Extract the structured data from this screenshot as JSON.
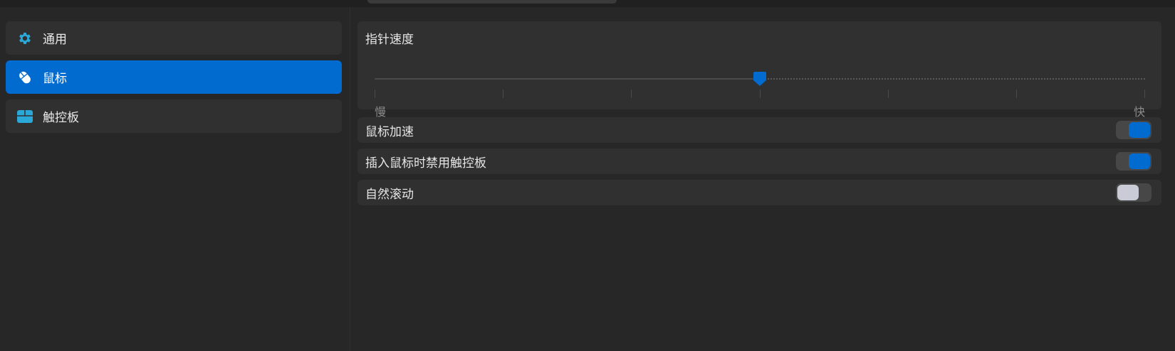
{
  "sidebar": {
    "items": [
      {
        "label": "通用",
        "icon": "gear-icon",
        "active": false
      },
      {
        "label": "鼠标",
        "icon": "mouse-icon",
        "active": true
      },
      {
        "label": "触控板",
        "icon": "touchpad-icon",
        "active": false
      }
    ]
  },
  "pointer_speed": {
    "title": "指针速度",
    "min_label": "慢",
    "max_label": "快",
    "value_fraction": 0.5,
    "ticks": 7
  },
  "settings": [
    {
      "label": "鼠标加速",
      "enabled": true
    },
    {
      "label": "插入鼠标时禁用触控板",
      "enabled": true
    },
    {
      "label": "自然滚动",
      "enabled": false
    }
  ],
  "colors": {
    "accent": "#016bd0",
    "icon_accent": "#2aa9d8",
    "background": "#272727",
    "card": "#303030"
  }
}
